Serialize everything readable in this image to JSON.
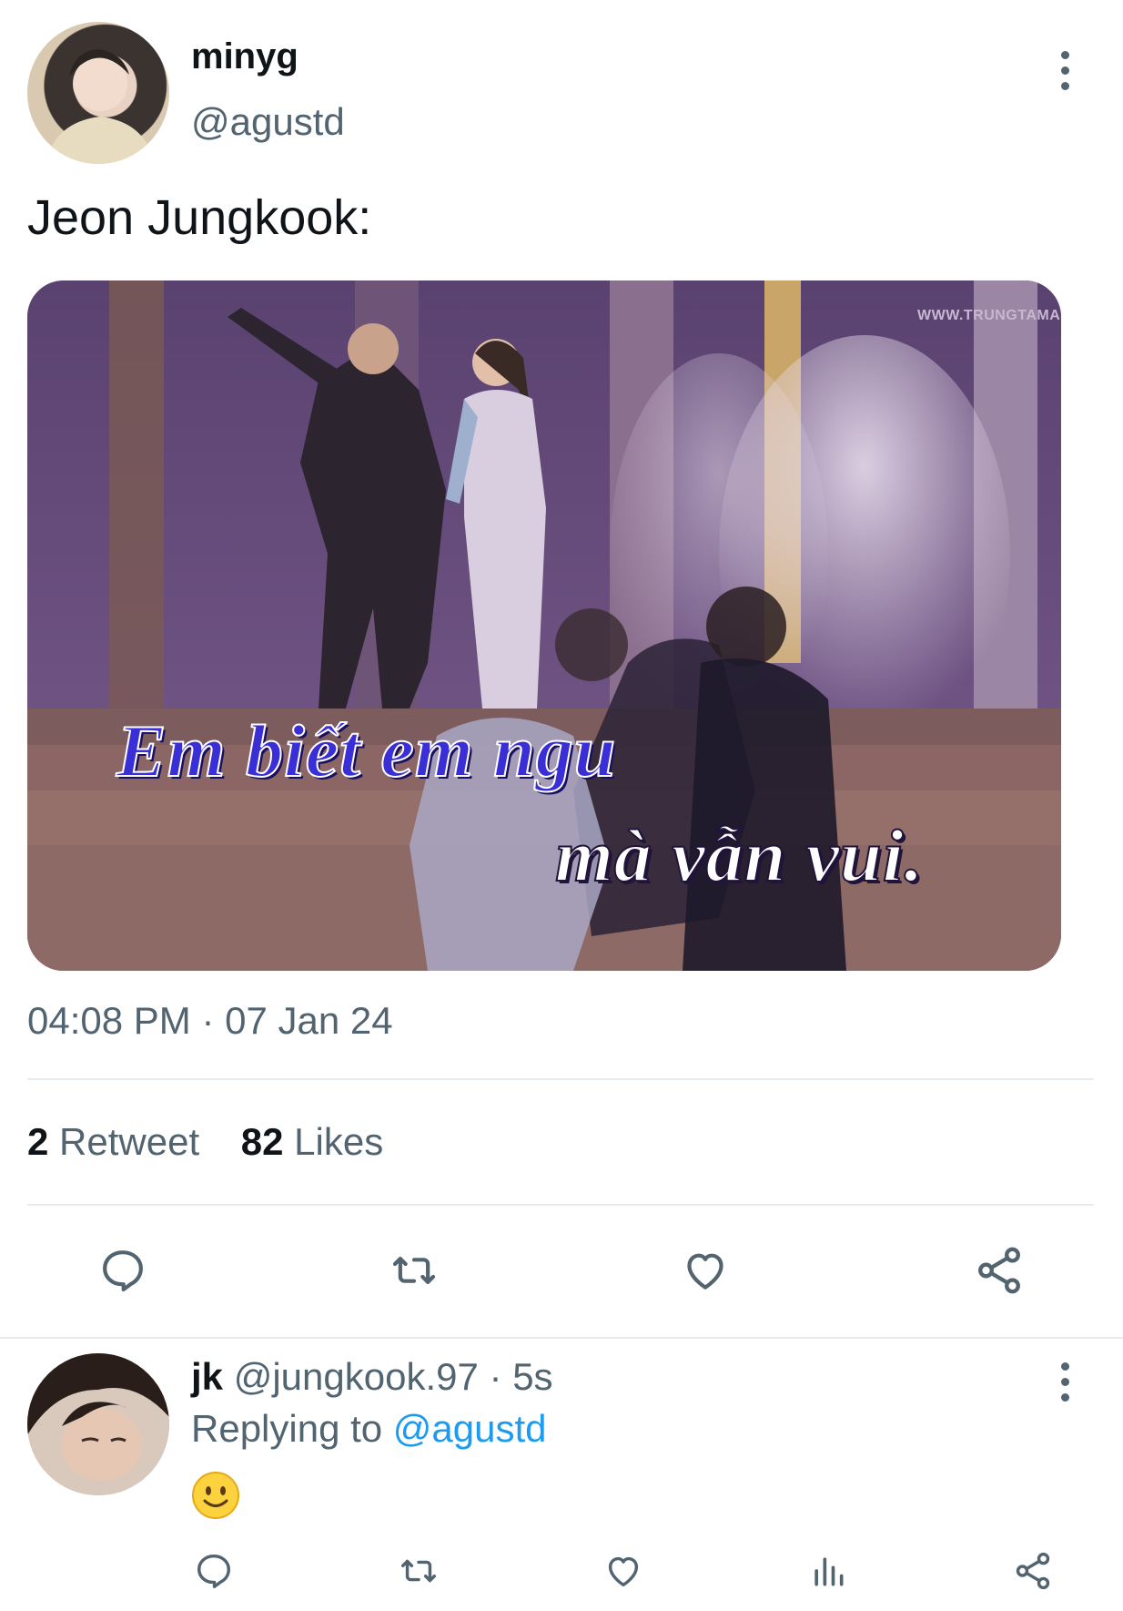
{
  "tweet": {
    "display_name": "minyg",
    "handle": "@agustd",
    "text": "Jeon Jungkook:",
    "media": {
      "watermark": "WWW.TRUNGTAMAS",
      "subtitle_line1": "Em biết em ngu",
      "subtitle_line2": "mà vẫn vui."
    },
    "time": "04:08 PM",
    "separator": "·",
    "date": "07 Jan 24",
    "stats": {
      "retweet_count": "2",
      "retweet_label": "Retweet",
      "likes_count": "82",
      "likes_label": "Likes"
    },
    "actions": [
      "reply-icon",
      "retweet-icon",
      "heart-icon",
      "share-icon"
    ]
  },
  "reply": {
    "display_name": "jk",
    "handle": "@jungkook.97",
    "separator": "·",
    "time": "5s",
    "replying_to_label": "Replying to",
    "replying_to_handle": "@agustd",
    "content_emoji": "smiling-face-emoji",
    "actions": [
      "reply-icon",
      "retweet-icon",
      "heart-icon",
      "analytics-icon",
      "share-icon"
    ]
  },
  "colors": {
    "text": "#0f1419",
    "muted": "#536471",
    "link": "#1d9bf0",
    "divider": "#e6ecf0",
    "subtitle_fill": "#3a2fd6"
  }
}
